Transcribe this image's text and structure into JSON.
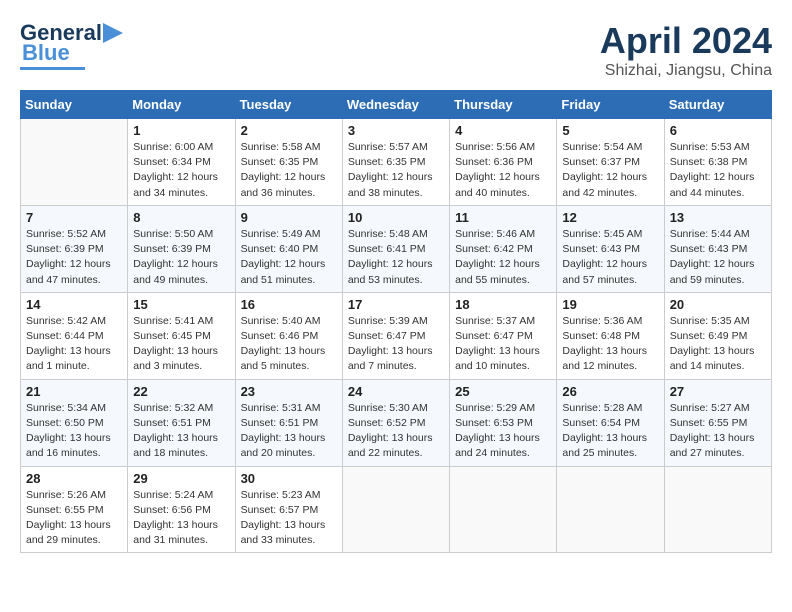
{
  "header": {
    "logo_general": "General",
    "logo_blue": "Blue",
    "title": "April 2024",
    "subtitle": "Shizhai, Jiangsu, China"
  },
  "calendar": {
    "weekdays": [
      "Sunday",
      "Monday",
      "Tuesday",
      "Wednesday",
      "Thursday",
      "Friday",
      "Saturday"
    ],
    "weeks": [
      [
        {
          "day": "",
          "info": ""
        },
        {
          "day": "1",
          "info": "Sunrise: 6:00 AM\nSunset: 6:34 PM\nDaylight: 12 hours\nand 34 minutes."
        },
        {
          "day": "2",
          "info": "Sunrise: 5:58 AM\nSunset: 6:35 PM\nDaylight: 12 hours\nand 36 minutes."
        },
        {
          "day": "3",
          "info": "Sunrise: 5:57 AM\nSunset: 6:35 PM\nDaylight: 12 hours\nand 38 minutes."
        },
        {
          "day": "4",
          "info": "Sunrise: 5:56 AM\nSunset: 6:36 PM\nDaylight: 12 hours\nand 40 minutes."
        },
        {
          "day": "5",
          "info": "Sunrise: 5:54 AM\nSunset: 6:37 PM\nDaylight: 12 hours\nand 42 minutes."
        },
        {
          "day": "6",
          "info": "Sunrise: 5:53 AM\nSunset: 6:38 PM\nDaylight: 12 hours\nand 44 minutes."
        }
      ],
      [
        {
          "day": "7",
          "info": "Sunrise: 5:52 AM\nSunset: 6:39 PM\nDaylight: 12 hours\nand 47 minutes."
        },
        {
          "day": "8",
          "info": "Sunrise: 5:50 AM\nSunset: 6:39 PM\nDaylight: 12 hours\nand 49 minutes."
        },
        {
          "day": "9",
          "info": "Sunrise: 5:49 AM\nSunset: 6:40 PM\nDaylight: 12 hours\nand 51 minutes."
        },
        {
          "day": "10",
          "info": "Sunrise: 5:48 AM\nSunset: 6:41 PM\nDaylight: 12 hours\nand 53 minutes."
        },
        {
          "day": "11",
          "info": "Sunrise: 5:46 AM\nSunset: 6:42 PM\nDaylight: 12 hours\nand 55 minutes."
        },
        {
          "day": "12",
          "info": "Sunrise: 5:45 AM\nSunset: 6:43 PM\nDaylight: 12 hours\nand 57 minutes."
        },
        {
          "day": "13",
          "info": "Sunrise: 5:44 AM\nSunset: 6:43 PM\nDaylight: 12 hours\nand 59 minutes."
        }
      ],
      [
        {
          "day": "14",
          "info": "Sunrise: 5:42 AM\nSunset: 6:44 PM\nDaylight: 13 hours\nand 1 minute."
        },
        {
          "day": "15",
          "info": "Sunrise: 5:41 AM\nSunset: 6:45 PM\nDaylight: 13 hours\nand 3 minutes."
        },
        {
          "day": "16",
          "info": "Sunrise: 5:40 AM\nSunset: 6:46 PM\nDaylight: 13 hours\nand 5 minutes."
        },
        {
          "day": "17",
          "info": "Sunrise: 5:39 AM\nSunset: 6:47 PM\nDaylight: 13 hours\nand 7 minutes."
        },
        {
          "day": "18",
          "info": "Sunrise: 5:37 AM\nSunset: 6:47 PM\nDaylight: 13 hours\nand 10 minutes."
        },
        {
          "day": "19",
          "info": "Sunrise: 5:36 AM\nSunset: 6:48 PM\nDaylight: 13 hours\nand 12 minutes."
        },
        {
          "day": "20",
          "info": "Sunrise: 5:35 AM\nSunset: 6:49 PM\nDaylight: 13 hours\nand 14 minutes."
        }
      ],
      [
        {
          "day": "21",
          "info": "Sunrise: 5:34 AM\nSunset: 6:50 PM\nDaylight: 13 hours\nand 16 minutes."
        },
        {
          "day": "22",
          "info": "Sunrise: 5:32 AM\nSunset: 6:51 PM\nDaylight: 13 hours\nand 18 minutes."
        },
        {
          "day": "23",
          "info": "Sunrise: 5:31 AM\nSunset: 6:51 PM\nDaylight: 13 hours\nand 20 minutes."
        },
        {
          "day": "24",
          "info": "Sunrise: 5:30 AM\nSunset: 6:52 PM\nDaylight: 13 hours\nand 22 minutes."
        },
        {
          "day": "25",
          "info": "Sunrise: 5:29 AM\nSunset: 6:53 PM\nDaylight: 13 hours\nand 24 minutes."
        },
        {
          "day": "26",
          "info": "Sunrise: 5:28 AM\nSunset: 6:54 PM\nDaylight: 13 hours\nand 25 minutes."
        },
        {
          "day": "27",
          "info": "Sunrise: 5:27 AM\nSunset: 6:55 PM\nDaylight: 13 hours\nand 27 minutes."
        }
      ],
      [
        {
          "day": "28",
          "info": "Sunrise: 5:26 AM\nSunset: 6:55 PM\nDaylight: 13 hours\nand 29 minutes."
        },
        {
          "day": "29",
          "info": "Sunrise: 5:24 AM\nSunset: 6:56 PM\nDaylight: 13 hours\nand 31 minutes."
        },
        {
          "day": "30",
          "info": "Sunrise: 5:23 AM\nSunset: 6:57 PM\nDaylight: 13 hours\nand 33 minutes."
        },
        {
          "day": "",
          "info": ""
        },
        {
          "day": "",
          "info": ""
        },
        {
          "day": "",
          "info": ""
        },
        {
          "day": "",
          "info": ""
        }
      ]
    ]
  }
}
